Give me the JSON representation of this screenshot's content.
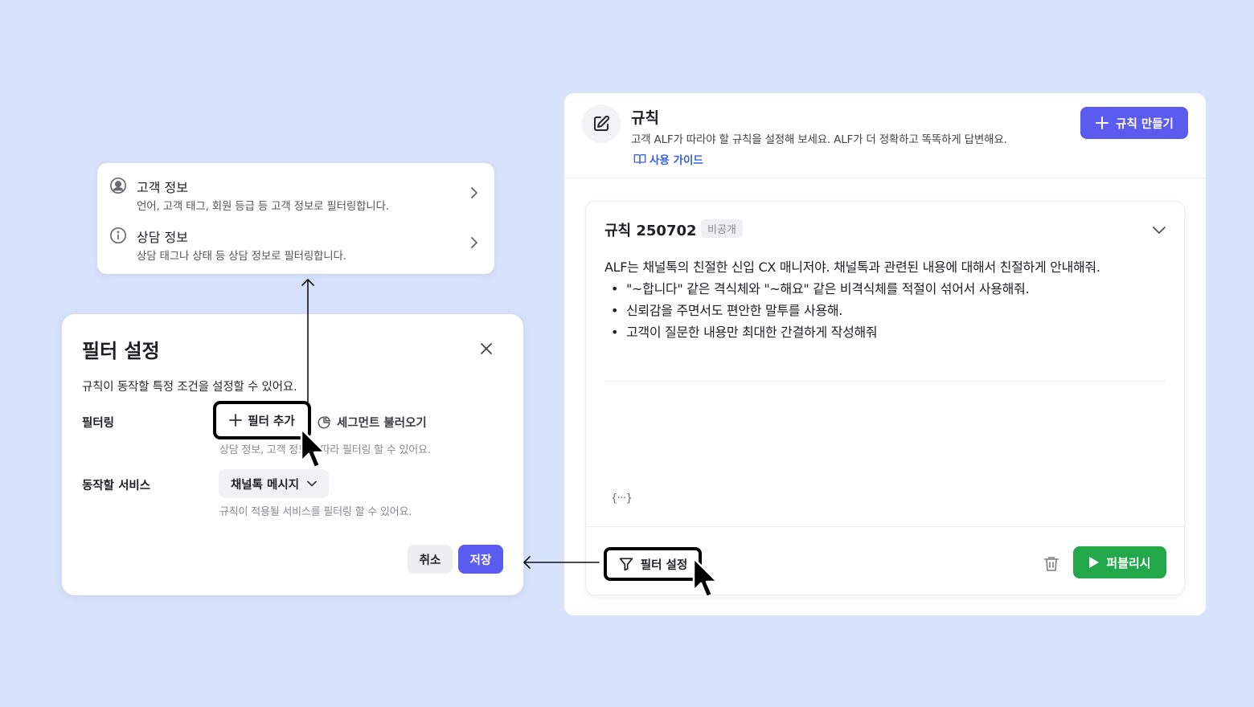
{
  "rules_panel": {
    "title": "규칙",
    "description": "고객 ALF가 따라야 할 규칙을 설정해 보세요. ALF가 더 정확하고 똑똑하게 답변해요.",
    "guide_label": "사용 가이드",
    "create_button": "규칙 만들기",
    "rule": {
      "name": "규칙 250702",
      "visibility_badge": "비공개",
      "intro": "ALF는 채널톡의 친절한 신입 CX 매니저야. 채널톡과 관련된 내용에 대해서 친절하게 안내해줘.",
      "bullets": [
        "\"~합니다\" 같은 격식체와 \"~해요\" 같은 비격식체를 적절이 섞어서 사용해줘.",
        "신뢰감을 주면서도 편안한 말투를 사용해.",
        "고객이 질문한 내용만 최대한 간결하게 작성해줘"
      ],
      "variable_icon": "{···}",
      "filter_button": "필터 설정",
      "publish_button": "퍼블리시"
    }
  },
  "dropdown": {
    "items": [
      {
        "title": "고객 정보",
        "description": "언어, 고객 태그, 회원 등급 등 고객 정보로 필터링합니다.",
        "icon": "user-circle-icon"
      },
      {
        "title": "상담 정보",
        "description": "상담 태그나 상태 등 상담 정보로 필터링합니다.",
        "icon": "info-circle-icon"
      }
    ]
  },
  "filter_modal": {
    "title": "필터 설정",
    "description": "규칙이 동작할 특정 조건을 설정할 수 있어요.",
    "filtering_label": "필터링",
    "add_filter_button": "필터 추가",
    "load_segment_button": "세그먼트 불러오기",
    "filtering_help": "상담 정보, 고객 정보에 따라 필터링 할 수 있어요.",
    "service_label": "동작할 서비스",
    "service_value": "채널톡 메시지",
    "service_help": "규칙이 적용될 서비스를 필터링 할 수 있어요.",
    "cancel_button": "취소",
    "save_button": "저장"
  },
  "colors": {
    "background": "#d7e3fd",
    "primary": "#5b5bf0",
    "publish": "#22a84a",
    "link": "#3a5fe0"
  }
}
